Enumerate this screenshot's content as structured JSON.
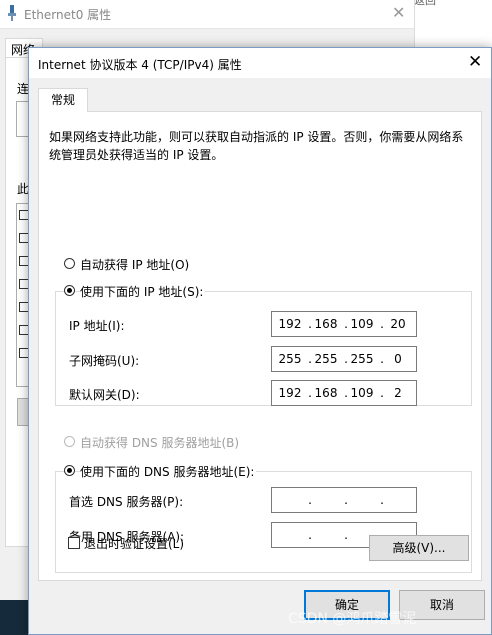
{
  "background_window": {
    "title": "Ethernet0 属性",
    "close_glyph": "✕",
    "tab_label": "网络",
    "connect_label": "连",
    "items_label": "此"
  },
  "far_window_text": "返回",
  "dialog": {
    "title": "Internet 协议版本 4 (TCP/IPv4) 属性",
    "close_glyph": "✕",
    "tab_general": "常规",
    "description": "如果网络支持此功能，则可以获取自动指派的 IP 设置。否则，你需要从网络系统管理员处获得适当的 IP 设置。",
    "ip_auto_label": "自动获得 IP 地址(O)",
    "ip_manual_label": "使用下面的 IP 地址(S):",
    "ip_address_label": "IP 地址(I):",
    "ip_address": [
      "192",
      "168",
      "109",
      "20"
    ],
    "subnet_mask_label": "子网掩码(U):",
    "subnet_mask": [
      "255",
      "255",
      "255",
      "0"
    ],
    "gateway_label": "默认网关(D):",
    "gateway": [
      "192",
      "168",
      "109",
      "2"
    ],
    "dns_auto_label": "自动获得 DNS 服务器地址(B)",
    "dns_manual_label": "使用下面的 DNS 服务器地址(E):",
    "preferred_dns_label": "首选 DNS 服务器(P):",
    "preferred_dns": [
      "",
      "",
      "",
      ""
    ],
    "alternate_dns_label": "备用 DNS 服务器(A):",
    "alternate_dns": [
      "",
      "",
      "",
      ""
    ],
    "validate_label": "退出时验证设置(L)",
    "advanced_button": "高级(V)...",
    "ok_button": "确定",
    "cancel_button": "取消"
  },
  "watermark": "CSDN @鸿爪踏雪泥"
}
